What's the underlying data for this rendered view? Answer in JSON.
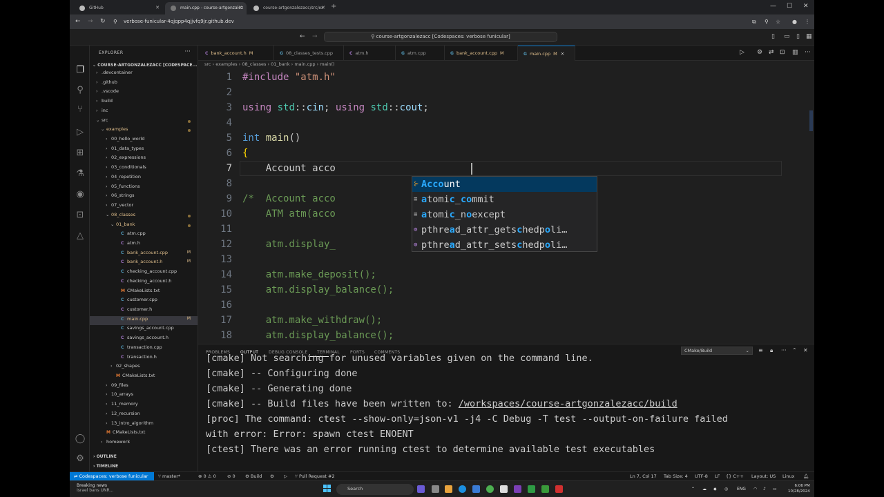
{
  "browser": {
    "tabs": [
      {
        "label": "GitHub"
      },
      {
        "label": "main.cpp - course-artgonzalez"
      },
      {
        "label": "course-artgonzalezacc/src/ex"
      }
    ],
    "url": "verbose-funicular-4qjqpp4qjjvfq9jr.github.dev",
    "new_tab": "+"
  },
  "titlebar": {
    "command_center": "course-artgonzalezacc [Codespaces: verbose funicular]"
  },
  "explorer": {
    "title": "EXPLORER",
    "root": "COURSE-ARTGONZALEZACC [CODESPACE...",
    "items": [
      {
        "label": ".devcontainer",
        "depth": 1,
        "chev": "›",
        "icon": ""
      },
      {
        "label": ".github",
        "depth": 1,
        "chev": "›",
        "icon": ""
      },
      {
        "label": ".vscode",
        "depth": 1,
        "chev": "›",
        "icon": ""
      },
      {
        "label": "build",
        "depth": 1,
        "chev": "›",
        "icon": ""
      },
      {
        "label": "inc",
        "depth": 1,
        "chev": "›",
        "icon": ""
      },
      {
        "label": "src",
        "depth": 1,
        "chev": "⌄",
        "icon": "",
        "dot": true
      },
      {
        "label": "examples",
        "depth": 2,
        "chev": "⌄",
        "icon": "",
        "dot": true,
        "orange": true
      },
      {
        "label": "00_hello_world",
        "depth": 3,
        "chev": "›",
        "icon": ""
      },
      {
        "label": "01_data_types",
        "depth": 3,
        "chev": "›",
        "icon": ""
      },
      {
        "label": "02_expressions",
        "depth": 3,
        "chev": "›",
        "icon": ""
      },
      {
        "label": "03_conditionals",
        "depth": 3,
        "chev": "›",
        "icon": ""
      },
      {
        "label": "04_repetition",
        "depth": 3,
        "chev": "›",
        "icon": ""
      },
      {
        "label": "05_functions",
        "depth": 3,
        "chev": "›",
        "icon": ""
      },
      {
        "label": "06_strings",
        "depth": 3,
        "chev": "›",
        "icon": ""
      },
      {
        "label": "07_vector",
        "depth": 3,
        "chev": "›",
        "icon": ""
      },
      {
        "label": "08_classes",
        "depth": 3,
        "chev": "⌄",
        "icon": "",
        "dot": true,
        "orange": true
      },
      {
        "label": "01_bank",
        "depth": 4,
        "chev": "⌄",
        "icon": "",
        "dot": true,
        "orange": true
      },
      {
        "label": "atm.cpp",
        "depth": 5,
        "chev": "",
        "icon": "C"
      },
      {
        "label": "atm.h",
        "depth": 5,
        "chev": "",
        "icon": "C"
      },
      {
        "label": "bank_account.cpp",
        "depth": 5,
        "chev": "",
        "icon": "C",
        "badge": "M",
        "orange": true
      },
      {
        "label": "bank_account.h",
        "depth": 5,
        "chev": "",
        "icon": "C",
        "badge": "M",
        "orange": true
      },
      {
        "label": "checking_account.cpp",
        "depth": 5,
        "chev": "",
        "icon": "C"
      },
      {
        "label": "checking_account.h",
        "depth": 5,
        "chev": "",
        "icon": "C"
      },
      {
        "label": "CMakeLists.txt",
        "depth": 5,
        "chev": "",
        "icon": "M"
      },
      {
        "label": "customer.cpp",
        "depth": 5,
        "chev": "",
        "icon": "C"
      },
      {
        "label": "customer.h",
        "depth": 5,
        "chev": "",
        "icon": "C"
      },
      {
        "label": "main.cpp",
        "depth": 5,
        "chev": "",
        "icon": "C",
        "badge": "M",
        "orange": true,
        "selected": true
      },
      {
        "label": "savings_account.cpp",
        "depth": 5,
        "chev": "",
        "icon": "C"
      },
      {
        "label": "savings_account.h",
        "depth": 5,
        "chev": "",
        "icon": "C"
      },
      {
        "label": "transaction.cpp",
        "depth": 5,
        "chev": "",
        "icon": "C"
      },
      {
        "label": "transaction.h",
        "depth": 5,
        "chev": "",
        "icon": "C"
      },
      {
        "label": "02_shapes",
        "depth": 4,
        "chev": "›",
        "icon": ""
      },
      {
        "label": "CMakeLists.txt",
        "depth": 4,
        "chev": "",
        "icon": "M"
      },
      {
        "label": "09_files",
        "depth": 3,
        "chev": "›",
        "icon": ""
      },
      {
        "label": "10_arrays",
        "depth": 3,
        "chev": "›",
        "icon": ""
      },
      {
        "label": "11_memory",
        "depth": 3,
        "chev": "›",
        "icon": ""
      },
      {
        "label": "12_recursion",
        "depth": 3,
        "chev": "›",
        "icon": ""
      },
      {
        "label": "13_intro_algorithm",
        "depth": 3,
        "chev": "›",
        "icon": ""
      },
      {
        "label": "CMakeLists.txt",
        "depth": 2,
        "chev": "",
        "icon": "M"
      },
      {
        "label": "homework",
        "depth": 2,
        "chev": "›",
        "icon": ""
      }
    ],
    "outline": "OUTLINE",
    "timeline": "TIMELINE"
  },
  "editor_tabs": [
    {
      "label": "bank_account.h",
      "lang": "C",
      "mod": "M"
    },
    {
      "label": "08_classes_tests.cpp",
      "lang": "G",
      "mod": ""
    },
    {
      "label": "atm.h",
      "lang": "C",
      "mod": ""
    },
    {
      "label": "atm.cpp",
      "lang": "G",
      "mod": ""
    },
    {
      "label": "bank_account.cpp",
      "lang": "G",
      "mod": "M"
    },
    {
      "label": "main.cpp",
      "lang": "G",
      "mod": "M",
      "active": true
    }
  ],
  "breadcrumb": "src › examples › 08_classes › 01_bank › main.cpp › main()",
  "code": {
    "line_numbers": [
      "1",
      "2",
      "3",
      "4",
      "5",
      "6",
      "7",
      "8",
      "9",
      "10",
      "11",
      "12",
      "13",
      "14",
      "15",
      "16",
      "17",
      "18"
    ],
    "current_line": 7
  },
  "suggestions": [
    {
      "pre": "",
      "hl": "Acco",
      "post": "unt",
      "selected": true
    },
    {
      "pre": "",
      "hl": "a",
      "post": "tomi",
      "hl2": "c",
      "post2": "_",
      "hl3": "co",
      "post3": "mmit"
    },
    {
      "pre": "",
      "hl": "a",
      "post": "tomi",
      "hl2": "c",
      "post2": "_n",
      "hl3": "o",
      "post3": "except"
    },
    {
      "pre": "pthre",
      "hl": "a",
      "post": "d_attr_gets",
      "hl2": "c",
      "post2": "hedp",
      "hl3": "o",
      "post3": "li…"
    },
    {
      "pre": "pthre",
      "hl": "a",
      "post": "d_attr_sets",
      "hl2": "c",
      "post2": "hedp",
      "hl3": "o",
      "post3": "li…"
    }
  ],
  "panel": {
    "tabs": [
      "PROBLEMS",
      "OUTPUT",
      "DEBUG CONSOLE",
      "TERMINAL",
      "PORTS",
      "COMMENTS"
    ],
    "active_tab": "OUTPUT",
    "channel": "CMake/Build",
    "lines": [
      "[cmake] Not searching for unused variables given on the command line.",
      "[cmake] -- Configuring done",
      "[cmake] -- Generating done",
      "[cmake] -- Build files have been written to: ",
      "[proc] The command: ctest --show-only=json-v1 -j4 -C Debug -T test --output-on-failure failed",
      "with error: Error: spawn ctest ENOENT",
      "[ctest] There was an error running ctest to determine available test executables"
    ],
    "build_path": "/workspaces/course-artgonzalezacc/build"
  },
  "statusbar": {
    "remote": "Codespaces: verbose funicular",
    "branch": "master*",
    "problems": "⊗ 0 ⚠ 0",
    "ports": "0",
    "build": "Build",
    "pr": "Pull Request #2",
    "position": "Ln 7, Col 17",
    "tabsize": "Tab Size: 4",
    "encoding": "UTF-8",
    "eol": "LF",
    "language": "C++",
    "layout": "Layout: US",
    "os": "Linux"
  },
  "taskbar": {
    "news_title": "Breaking news",
    "news_sub": "Israel bans UNR...",
    "search": "Search",
    "lang": "ENG",
    "time": "6:06 PM",
    "date": "10/28/2024"
  },
  "colors": {
    "accent": "#0078d4",
    "modified": "#e2c08d",
    "suggest_selected": "#04395e"
  }
}
